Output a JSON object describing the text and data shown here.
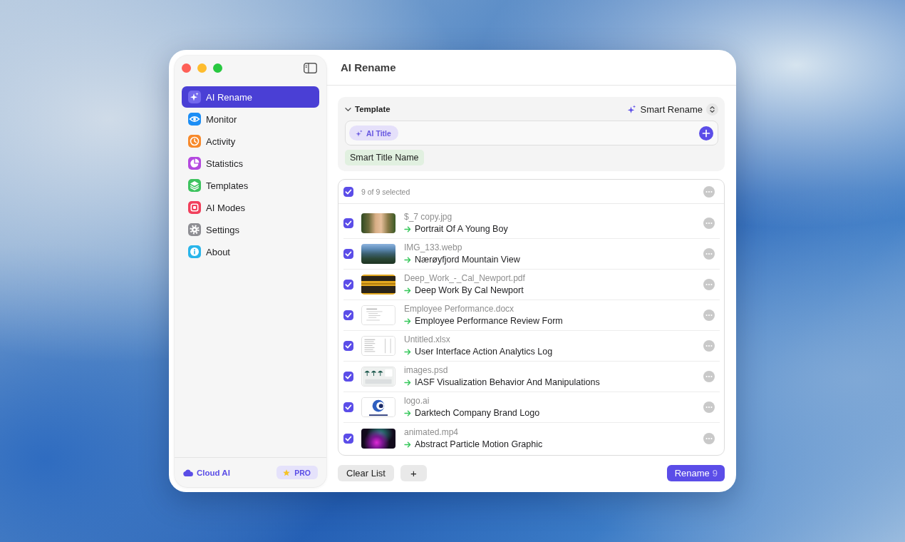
{
  "window": {
    "title": "AI Rename"
  },
  "sidebar": {
    "items": [
      {
        "label": "AI Rename",
        "selected": true,
        "color": "#7368ee"
      },
      {
        "label": "Monitor",
        "selected": false,
        "color": "#1c8ef5"
      },
      {
        "label": "Activity",
        "selected": false,
        "color": "#f7892b"
      },
      {
        "label": "Statistics",
        "selected": false,
        "color": "#b449df"
      },
      {
        "label": "Templates",
        "selected": false,
        "color": "#3ec35f"
      },
      {
        "label": "AI Modes",
        "selected": false,
        "color": "#f1405c"
      },
      {
        "label": "Settings",
        "selected": false,
        "color": "#8e8e93"
      },
      {
        "label": "About",
        "selected": false,
        "color": "#29b5ea"
      }
    ],
    "cloud_label": "Cloud AI",
    "badge": "PRO"
  },
  "template": {
    "label": "Template",
    "expanded": true,
    "mode": "Smart Rename",
    "tokens": [
      {
        "label": "AI Title"
      }
    ],
    "preview": "Smart Title Name"
  },
  "files": {
    "select_all": {
      "label": "9 of 9 selected",
      "checked": true
    },
    "rows": [
      {
        "kind": "photo",
        "original": "$_7 copy.jpg",
        "renamed": "Portrait Of A Young Boy",
        "checked": true
      },
      {
        "kind": "landscape",
        "original": "IMG_133.webp",
        "renamed": "Nærøyfjord Mountain View",
        "checked": true
      },
      {
        "kind": "cover",
        "original": "Deep_Work_-_Cal_Newport.pdf",
        "renamed": "Deep Work By Cal Newport",
        "checked": true
      },
      {
        "kind": "document",
        "original": "Employee Performance.docx",
        "renamed": "Employee Performance Review Form",
        "checked": true
      },
      {
        "kind": "spreadsheet",
        "original": "Untitled.xlsx",
        "renamed": "User Interface Action Analytics Log",
        "checked": true
      },
      {
        "kind": "mockup",
        "original": "images.psd",
        "renamed": "IASF Visualization Behavior And Manipulations",
        "checked": true
      },
      {
        "kind": "logo",
        "original": "logo.ai",
        "renamed": "Darktech Company Brand Logo",
        "checked": true
      },
      {
        "kind": "video",
        "original": "animated.mp4",
        "renamed": "Abstract Particle Motion Graphic",
        "checked": true
      }
    ]
  },
  "buttons": {
    "clear": "Clear List",
    "add": "+",
    "rename": {
      "label": "Rename",
      "count": "9"
    }
  }
}
